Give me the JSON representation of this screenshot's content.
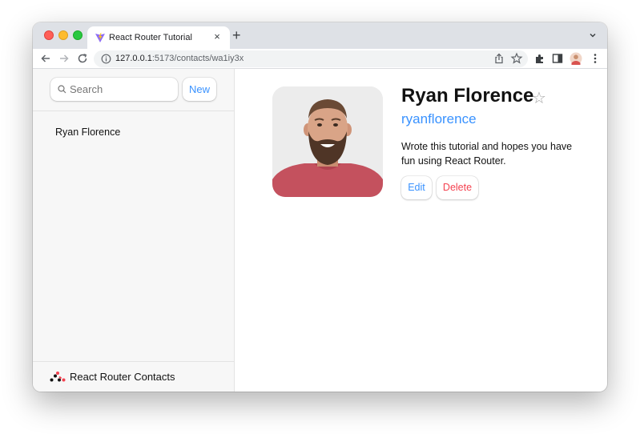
{
  "browser": {
    "tab": {
      "title": "React Router Tutorial",
      "close_glyph": "×",
      "favicon": "vite-icon"
    },
    "new_tab_glyph": "+",
    "address": {
      "host": "127.0.0.1",
      "path": ":5173/contacts/wa1iy3x"
    },
    "toolbar_icons": [
      "share-icon",
      "bookmark-star-icon",
      "extensions-icon",
      "side-panel-icon",
      "profile-avatar",
      "menu-icon"
    ]
  },
  "sidebar": {
    "search": {
      "placeholder": "Search",
      "value": ""
    },
    "new_button_label": "New",
    "contacts": [
      {
        "name": "Ryan Florence"
      }
    ],
    "footer_title": "React Router Contacts"
  },
  "contact": {
    "name": "Ryan Florence",
    "favorite_glyph": "☆",
    "handle": "ryanflorence",
    "notes": "Wrote this tutorial and hopes you have fun using React Router.",
    "edit_label": "Edit",
    "delete_label": "Delete"
  },
  "colors": {
    "accent": "#3992ff",
    "danger": "#f44250",
    "sidebar_bg": "#f7f7f7",
    "tabstrip_bg": "#dee1e6"
  }
}
